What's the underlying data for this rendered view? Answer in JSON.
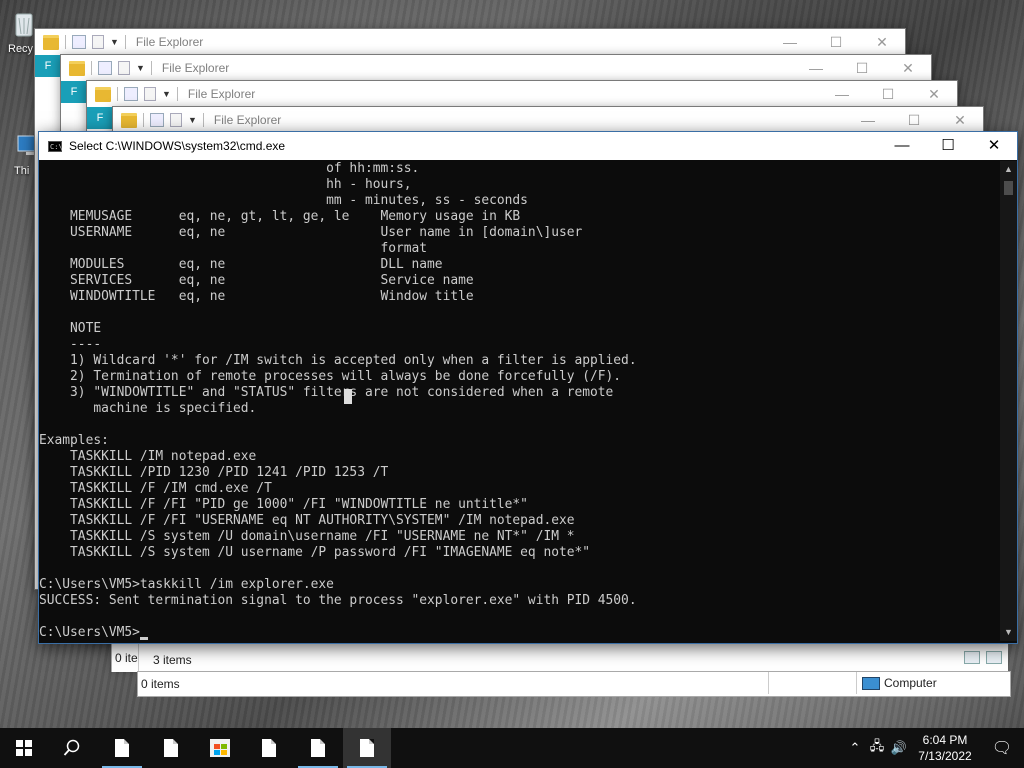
{
  "desktop": {
    "icons": [
      {
        "label": "Recy"
      },
      {
        "label": "Thi"
      }
    ]
  },
  "explorer_windows": [
    {
      "title": "File Explorer",
      "tab": "F"
    },
    {
      "title": "File Explorer",
      "tab": "F"
    },
    {
      "title": "File Explorer",
      "tab": "F"
    },
    {
      "title": "File Explorer",
      "tab": "F"
    }
  ],
  "explorer_status": {
    "items_back": "0 ite",
    "items_count": "3 items",
    "items_front": "0 items",
    "location": "Computer"
  },
  "cmd": {
    "title": "Select C:\\WINDOWS\\system32\\cmd.exe",
    "icon_text": "C:\\",
    "lines": [
      "                                     of hh:mm:ss.",
      "                                     hh - hours,",
      "                                     mm - minutes, ss - seconds",
      "    MEMUSAGE      eq, ne, gt, lt, ge, le    Memory usage in KB",
      "    USERNAME      eq, ne                    User name in [domain\\]user",
      "                                            format",
      "    MODULES       eq, ne                    DLL name",
      "    SERVICES      eq, ne                    Service name",
      "    WINDOWTITLE   eq, ne                    Window title",
      "",
      "    NOTE",
      "    ----",
      "    1) Wildcard '*' for /IM switch is accepted only when a filter is applied.",
      "    2) Termination of remote processes will always be done forcefully (/F).",
      "    3) \"WINDOWTITLE\" and \"STATUS\" filters are not considered when a remote",
      "       machine is specified.",
      "",
      "Examples:",
      "    TASKKILL /IM notepad.exe",
      "    TASKKILL /PID 1230 /PID 1241 /PID 1253 /T",
      "    TASKKILL /F /IM cmd.exe /T",
      "    TASKKILL /F /FI \"PID ge 1000\" /FI \"WINDOWTITLE ne untitle*\"",
      "    TASKKILL /F /FI \"USERNAME eq NT AUTHORITY\\SYSTEM\" /IM notepad.exe",
      "    TASKKILL /S system /U domain\\username /FI \"USERNAME ne NT*\" /IM *",
      "    TASKKILL /S system /U username /P password /FI \"IMAGENAME eq note*\"",
      "",
      "C:\\Users\\VM5>taskkill /im explorer.exe",
      "SUCCESS: Sent termination signal to the process \"explorer.exe\" with PID 4500.",
      ""
    ],
    "prompt": "C:\\Users\\VM5>"
  },
  "window_controls": {
    "minimize": "—",
    "maximize": "☐",
    "close": "✕"
  },
  "taskbar": {
    "time": "6:04 PM",
    "date": "7/13/2022",
    "tray_chevron": "⌃",
    "network": "🖧",
    "volume": "🔊",
    "notifications": "🗨"
  },
  "colors": {
    "console_bg": "#0c0c0c",
    "console_fg": "#cccccc",
    "explorer_accent": "#1a9fb8",
    "taskbar_bg": "#101010"
  }
}
